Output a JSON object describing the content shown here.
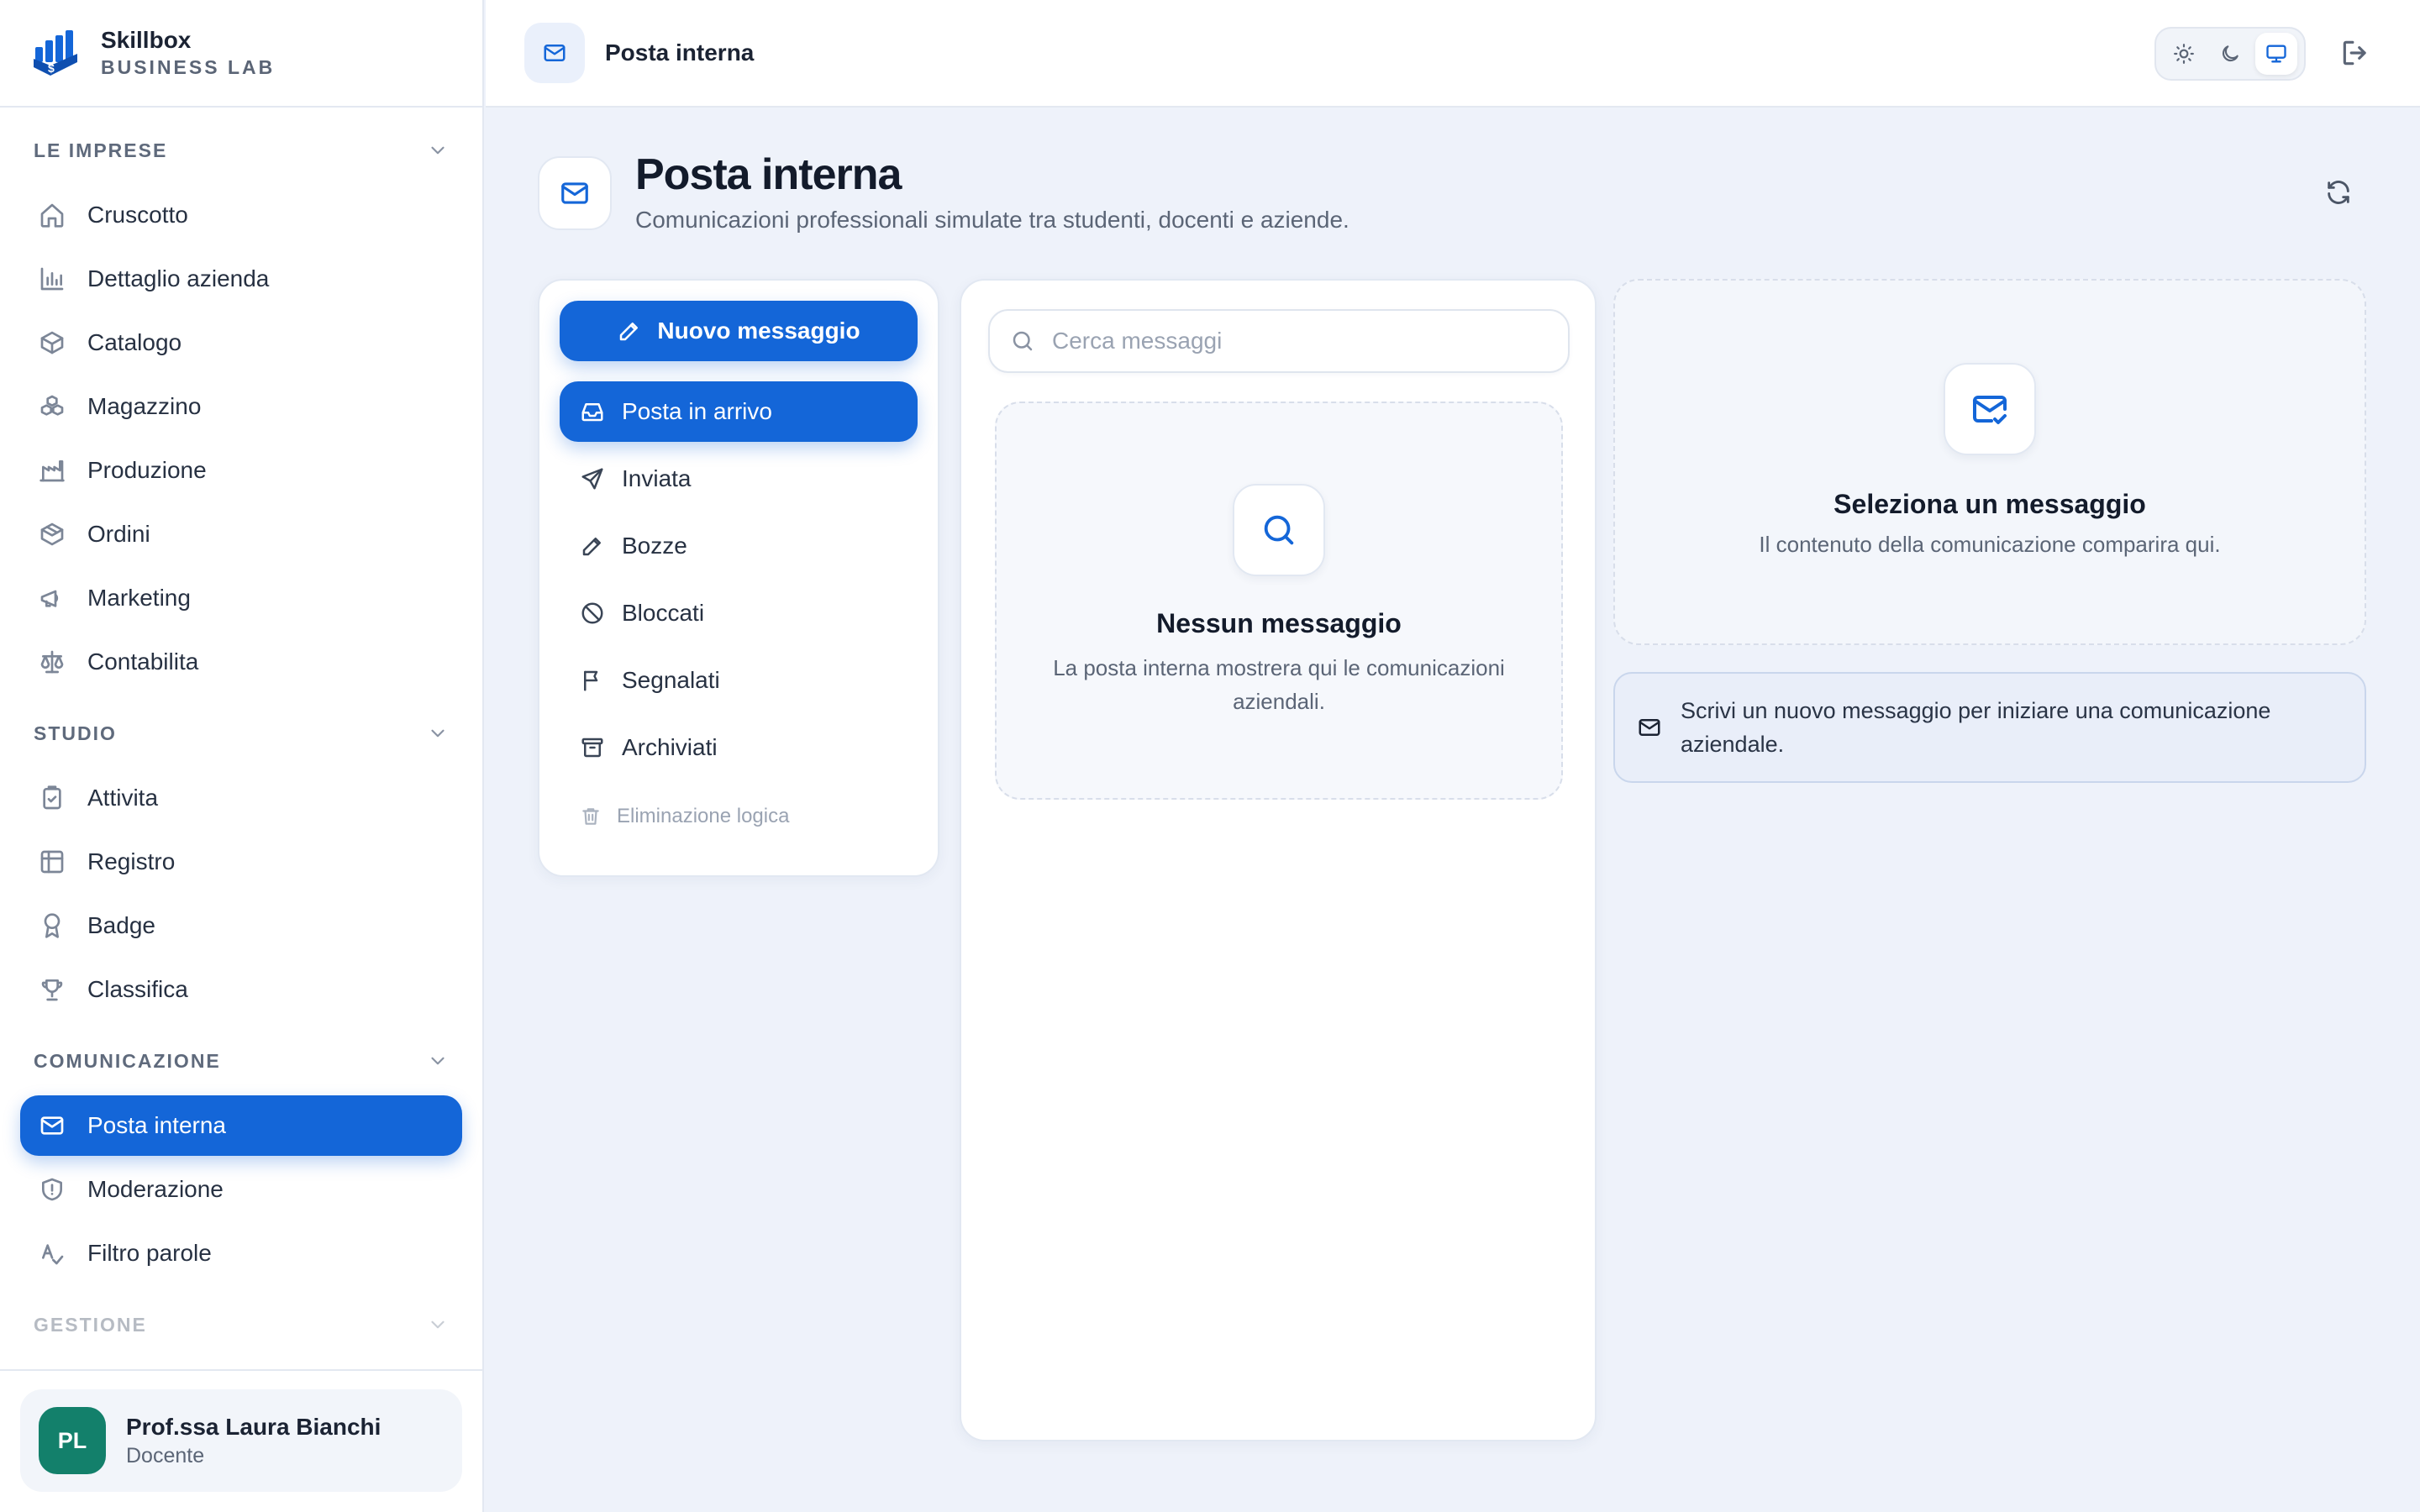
{
  "brand": {
    "name": "Skillbox",
    "subtitle": "BUSINESS LAB"
  },
  "sidebar": {
    "sections": [
      {
        "title": "LE IMPRESE",
        "items": [
          "Cruscotto",
          "Dettaglio azienda",
          "Catalogo",
          "Magazzino",
          "Produzione",
          "Ordini",
          "Marketing",
          "Contabilita"
        ]
      },
      {
        "title": "STUDIO",
        "items": [
          "Attivita",
          "Registro",
          "Badge",
          "Classifica"
        ]
      },
      {
        "title": "COMUNICAZIONE",
        "items": [
          "Posta interna",
          "Moderazione",
          "Filtro parole"
        ]
      },
      {
        "title": "GESTIONE",
        "items": []
      }
    ],
    "active_item": "Posta interna",
    "user": {
      "initials": "PL",
      "name": "Prof.ssa Laura Bianchi",
      "role": "Docente"
    }
  },
  "topbar": {
    "title": "Posta interna",
    "theme_selected": "system"
  },
  "page": {
    "title": "Posta interna",
    "subtitle": "Comunicazioni professionali simulate tra studenti, docenti e aziende."
  },
  "folders": {
    "compose_label": "Nuovo messaggio",
    "items": [
      "Posta in arrivo",
      "Inviata",
      "Bozze",
      "Bloccati",
      "Segnalati",
      "Archiviati"
    ],
    "active": "Posta in arrivo",
    "logic_delete_label": "Eliminazione logica"
  },
  "list": {
    "search_placeholder": "Cerca messaggi",
    "search_value": "",
    "empty_title": "Nessun messaggio",
    "empty_text": "La posta interna mostrera qui le comunicazioni aziendali."
  },
  "reader": {
    "empty_title": "Seleziona un messaggio",
    "empty_text": "Il contenuto della comunicazione comparira qui.",
    "hint": "Scrivi un nuovo messaggio per iniziare una comunicazione aziendale."
  },
  "colors": {
    "accent": "#1466d8",
    "avatar": "#13806b",
    "background": "#eef2fa"
  }
}
